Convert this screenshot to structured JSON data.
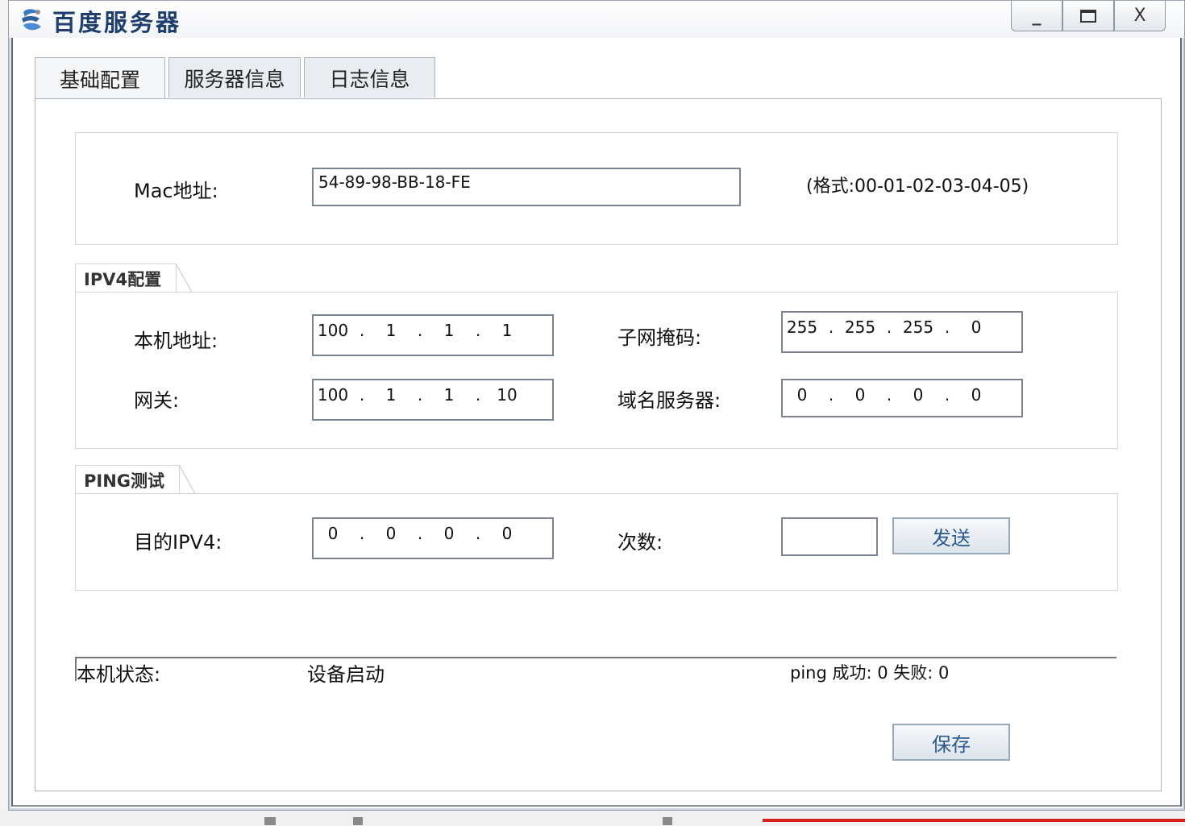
{
  "window": {
    "title": "百度服务器",
    "minimize_label": "_",
    "maximize_label": "□",
    "close_label": "X"
  },
  "tabs": [
    {
      "label": "基础配置",
      "active": true
    },
    {
      "label": "服务器信息",
      "active": false
    },
    {
      "label": "日志信息",
      "active": false
    }
  ],
  "mac": {
    "label": "Mac地址:",
    "value": "54-89-98-BB-18-FE",
    "format_hint": "(格式:00-01-02-03-04-05)"
  },
  "ipv4": {
    "group_title": "IPV4配置",
    "local_address": {
      "label": "本机地址:",
      "octets": [
        "100",
        "1",
        "1",
        "1"
      ]
    },
    "subnet_mask": {
      "label": "子网掩码:",
      "octets": [
        "255",
        "255",
        "255",
        "0"
      ]
    },
    "gateway": {
      "label": "网关:",
      "octets": [
        "100",
        "1",
        "1",
        "10"
      ]
    },
    "dns": {
      "label": "域名服务器:",
      "octets": [
        "0",
        "0",
        "0",
        "0"
      ]
    }
  },
  "ping": {
    "group_title": "PING测试",
    "target": {
      "label": "目的IPV4:",
      "octets": [
        "0",
        "0",
        "0",
        "0"
      ]
    },
    "count": {
      "label": "次数:",
      "value": ""
    },
    "send_label": "发送"
  },
  "status": {
    "label": "本机状态:",
    "value": "设备启动",
    "ping_result": "ping 成功: 0 失败: 0"
  },
  "save_label": "保存",
  "colors": {
    "title_text": "#1e3f6e",
    "button_text": "#2b5a8f",
    "background_red_line": "#d62020"
  }
}
